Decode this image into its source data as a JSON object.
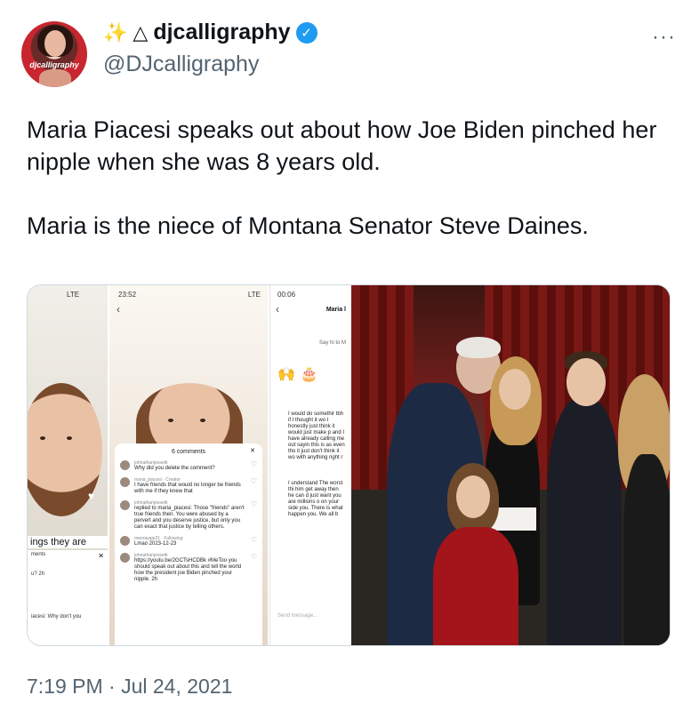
{
  "author": {
    "avatar_label": "djcalligraphy",
    "display_name_prefix": "✨",
    "display_name_glyph": "△",
    "display_name": "djcalligraphy",
    "handle": "@DJcalligraphy",
    "verified": true,
    "verified_icon": "verified-badge-icon"
  },
  "more_label": "···",
  "tweet": {
    "paragraph_1": "Maria Piacesi speaks out about how Joe Biden pinched her nipple when she was 8 years old.",
    "paragraph_2": "Maria is the niece of Montana Senator Steve Daines."
  },
  "media": {
    "panel_1": {
      "status": "LTE",
      "banner": "ings they are",
      "comment_1": "ments",
      "comment_2": "u? 2h",
      "comment_3": "iacesi: Why don't you"
    },
    "panel_2": {
      "status_time": "23:52",
      "status_right": "LTE",
      "sheet_title": "6 comments",
      "comments": [
        {
          "user": "johnathanjessetti",
          "text": "Why did you delete the comment?"
        },
        {
          "user": "maria_piacesi · Creator",
          "text": "I have friends that would no longer be friends with me if they knew that"
        },
        {
          "user": "johnathanjessetti",
          "text": "replied to maria_piacesi: Those \"friends\" aren't true friends then. You were abused by a pervert and you deserve justice, but only you can exact that justice by telling others."
        },
        {
          "user": "meerayaje21 · Following",
          "text": "Lmao 2023-12-23"
        },
        {
          "user": "johnathanjessetti",
          "text": "https://youtu.be/2GCTsHCDBk #MeToo you should speak out about this and tell the world how the president joe Biden pinched your nipple. 2h"
        }
      ]
    },
    "panel_3": {
      "status_time": "00:06",
      "contact": "Maria l",
      "say_hi": "Say hi to M",
      "messages": [
        "I would do somethir tbh if I thought it wo I honestly just think it would just make p and I have already calling me out sayin this is as even tho it just don't think it wo with anything right r",
        "I understand The worst thi him get away then he can d just want you are millions o on your side you. There is what happen you. We all b"
      ],
      "send_placeholder": "Send message..."
    }
  },
  "timestamp": "7:19 PM · Jul 24, 2021"
}
